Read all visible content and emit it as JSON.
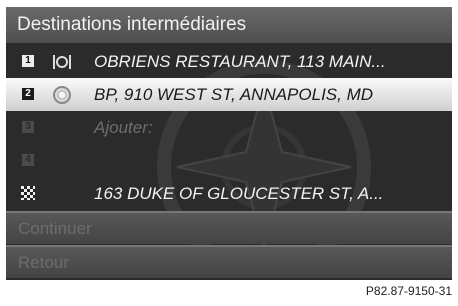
{
  "header": {
    "title": "Destinations intermédiaires"
  },
  "rows": [
    {
      "num": "1",
      "icon": "restaurant-icon",
      "text": "OBRIENS RESTAURANT, 113 MAIN..."
    },
    {
      "num": "2",
      "icon": "gas-station-icon",
      "text": "BP, 910 WEST ST, ANNAPOLIS, MD"
    },
    {
      "num": "3",
      "icon": "",
      "text": "Ajouter:"
    },
    {
      "num": "4",
      "icon": "",
      "text": ""
    },
    {
      "num": "",
      "icon": "checkered-flag-icon",
      "text": "163 DUKE OF GLOUCESTER ST, A..."
    }
  ],
  "actions": {
    "continue": "Continuer",
    "back": "Retour"
  },
  "caption": "P82.87-9150-31"
}
